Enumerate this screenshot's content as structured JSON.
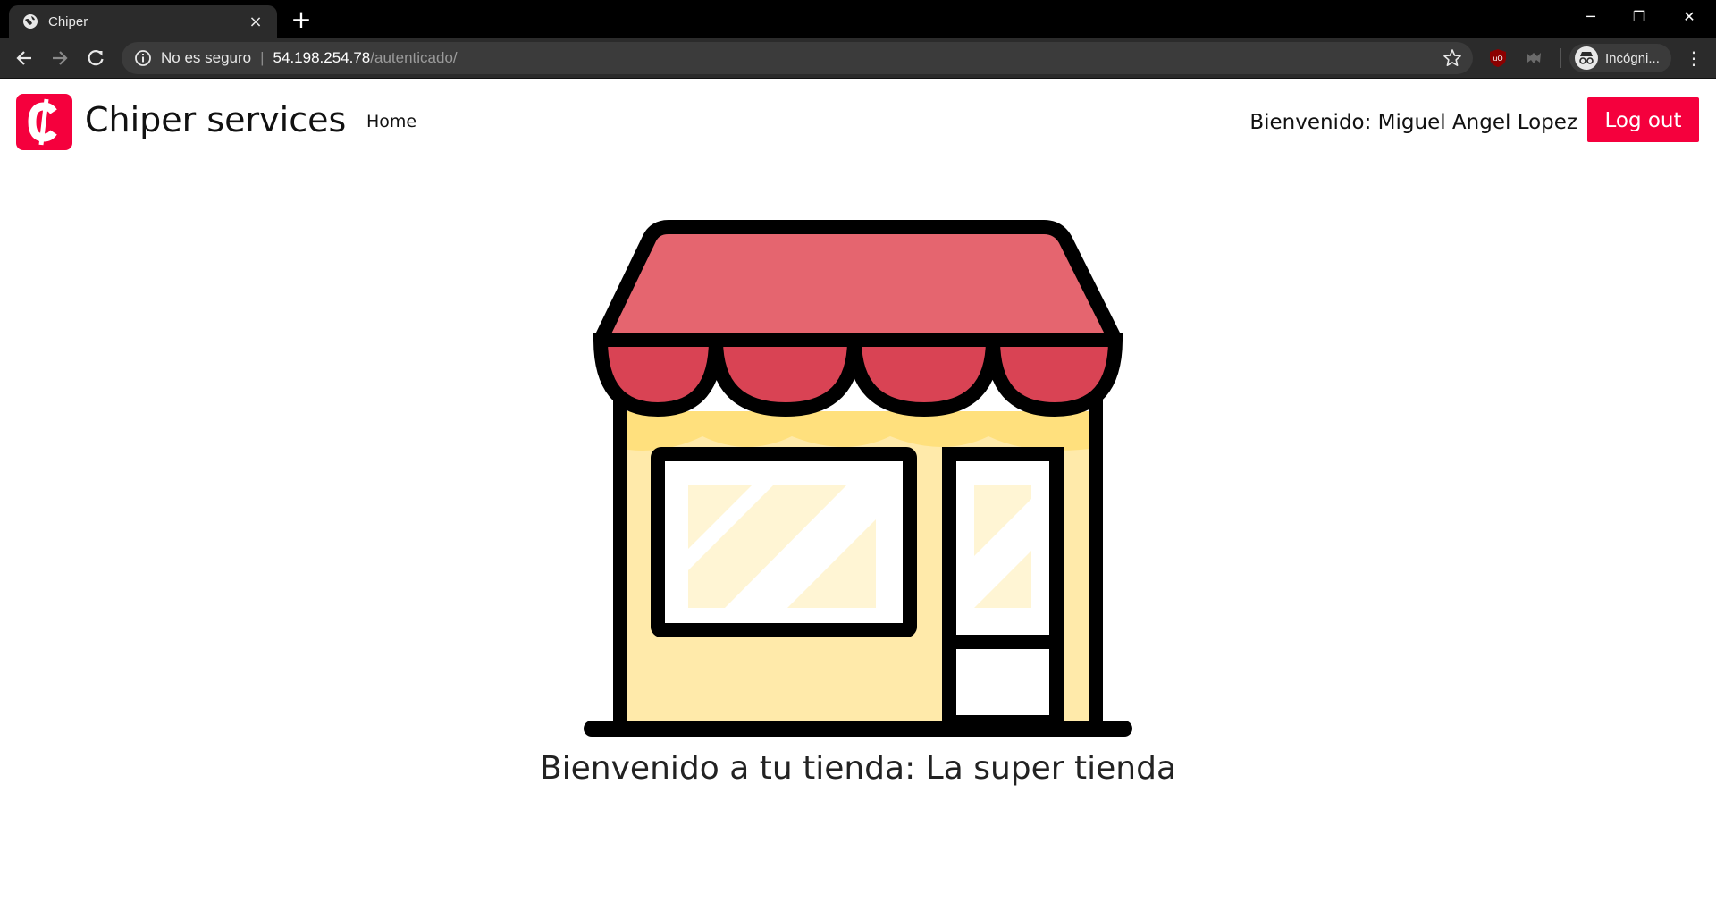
{
  "browser": {
    "tab_title": "Chiper",
    "tab_close": "×",
    "new_tab": "+",
    "window_controls": {
      "minimize": "─",
      "restore": "❐",
      "close": "✕"
    },
    "address": {
      "security_label": "No es seguro",
      "separator": "|",
      "host": "54.198.254.78",
      "path": "/autenticado/"
    },
    "profile_label": "Incógni...",
    "menu": "⋮"
  },
  "navbar": {
    "brand_name": "Chiper services",
    "logo_glyph": "₵",
    "home_link": "Home",
    "welcome_user": "Bienvenido: Miguel Angel Lopez",
    "logout_label": "Log out"
  },
  "main": {
    "store_welcome": "Bienvenido a tu tienda: La super tienda"
  },
  "colors": {
    "brand_red": "#f5003d",
    "awning_top": "#e5656f",
    "awning_scallop": "#d94354",
    "wall": "#ffeaaa",
    "wall_shadow": "#ffe07d",
    "glass": "#fff5d4"
  },
  "icons": {
    "tab": "globe-icon",
    "back": "back-arrow-icon",
    "forward": "forward-arrow-icon",
    "reload": "reload-icon",
    "security": "info-icon",
    "bookmark": "star-icon",
    "extension_1": "ublock-icon",
    "extension_2": "mask-extension-icon",
    "profile": "incognito-icon",
    "logo": "chiper-logo-icon",
    "illustration": "storefront-icon"
  }
}
